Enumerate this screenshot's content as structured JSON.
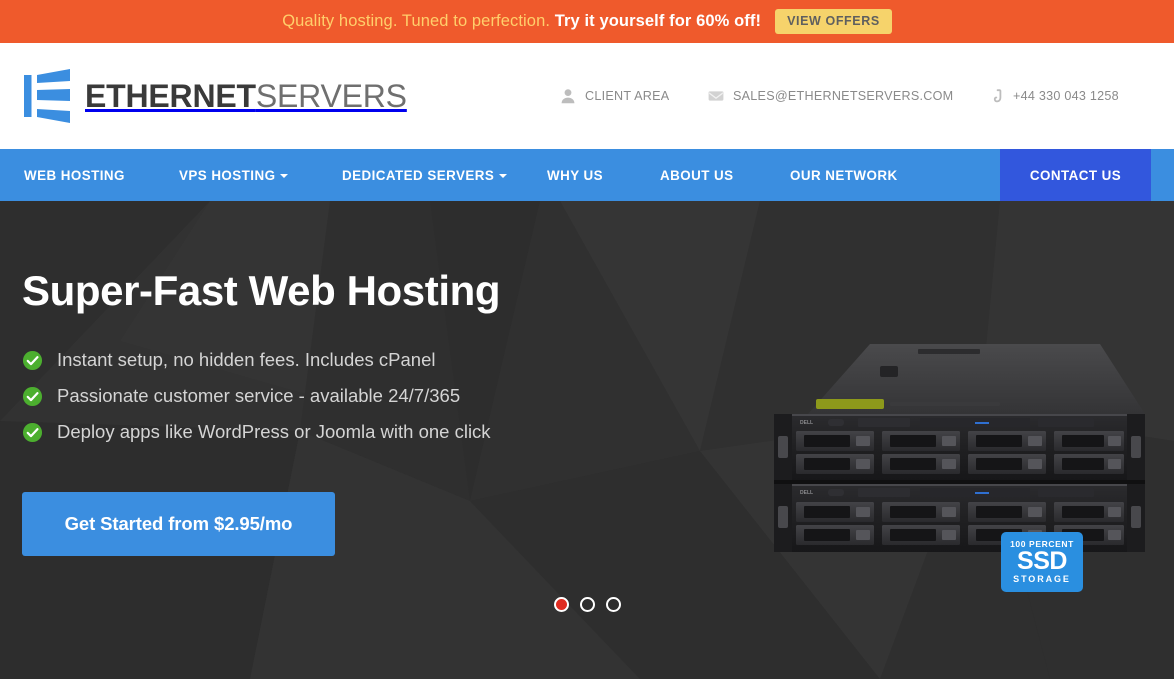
{
  "promo": {
    "text_plain": "Quality hosting. Tuned to perfection. ",
    "text_bold": "Try it yourself for 60% off!",
    "button_label": "VIEW OFFERS",
    "bg_color": "#ef5a2c",
    "plain_color": "#ffcf6b",
    "button_bg": "#f6d36b"
  },
  "header": {
    "logo": {
      "icon": "ethernet-e-logo-icon",
      "name_bold": "ETHERNET",
      "name_light": "SERVERS",
      "color": "#3b8ee0"
    },
    "contacts": [
      {
        "icon": "user-icon",
        "label": "CLIENT AREA"
      },
      {
        "icon": "envelope-icon",
        "label": "SALES@ETHERNETSERVERS.COM"
      },
      {
        "icon": "phone-icon",
        "label": "+44 330 043 1258"
      }
    ]
  },
  "nav": {
    "bg_color": "#3b8ee0",
    "active_bg_color": "#3257dd",
    "items": [
      {
        "label": "WEB HOSTING",
        "has_caret": false
      },
      {
        "label": "VPS HOSTING",
        "has_caret": true
      },
      {
        "label": "DEDICATED SERVERS",
        "has_caret": true
      },
      {
        "label": "WHY US",
        "has_caret": false
      },
      {
        "label": "ABOUT US",
        "has_caret": false
      },
      {
        "label": "OUR NETWORK",
        "has_caret": false
      }
    ],
    "contact_label": "CONTACT US"
  },
  "hero": {
    "title": "Super-Fast Web Hosting",
    "bullets": [
      "Instant setup, no hidden fees. Includes cPanel",
      "Passionate customer service - available 24/7/365",
      "Deploy apps like WordPress or Joomla with one click"
    ],
    "bullet_icon": "check-circle-icon",
    "bullet_icon_color": "#4caf2f",
    "cta_label": "Get Started from $2.95/mo",
    "cta_bg": "#3b8ee0",
    "bg_color": "#323232",
    "badge": {
      "line1": "100 PERCENT",
      "line2": "SSD",
      "line3": "STORAGE",
      "bg_color": "#2a8fe0"
    },
    "carousel": {
      "total": 3,
      "active_index": 0,
      "active_color": "#e02b20"
    }
  }
}
